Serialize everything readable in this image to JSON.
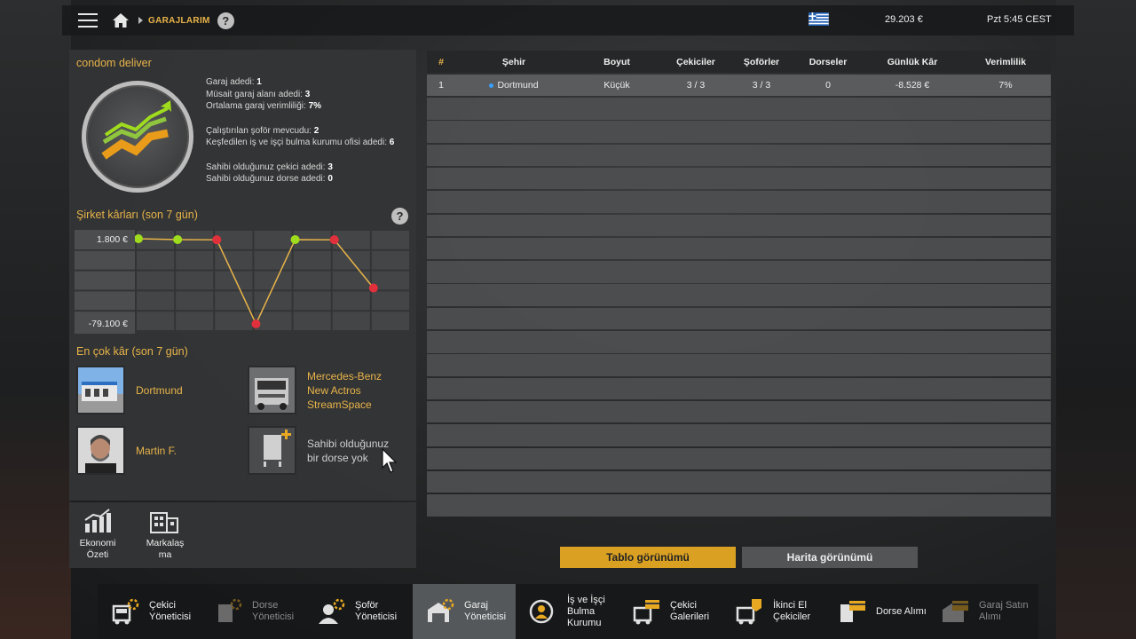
{
  "topbar": {
    "breadcrumb": "GARAJLARIM",
    "help": "?",
    "money": "29.203 €",
    "clock": "Pzt 5:45 CEST"
  },
  "company": {
    "name": "condom deliver",
    "stats": {
      "garages_label": "Garaj adedi:",
      "garages_value": "1",
      "free_slots_label": "Müsait garaj alanı adedi:",
      "free_slots_value": "3",
      "avg_eff_label": "Ortalama garaj verimliliği:",
      "avg_eff_value": "7%",
      "drivers_label": "Çalıştırılan şoför mevcudu:",
      "drivers_value": "2",
      "offices_label": "Keşfedilen iş ve işçi bulma kurumu ofisi adedi:",
      "offices_value": "6",
      "trucks_label": "Sahibi olduğunuz çekici adedi:",
      "trucks_value": "3",
      "trailers_label": "Sahibi olduğunuz dorse adedi:",
      "trailers_value": "0"
    }
  },
  "profit_chart": {
    "title": "Şirket kârları (son 7 gün)",
    "help": "?",
    "max_label": "1.800 €",
    "min_label": "-79.100 €"
  },
  "chart_data": {
    "type": "line",
    "title": "Şirket kârları (son 7 gün)",
    "x": [
      1,
      2,
      3,
      4,
      5,
      6,
      7
    ],
    "series": [
      {
        "values": [
          1800,
          1000,
          800,
          -79100,
          1000,
          800,
          -45000
        ]
      }
    ],
    "point_status": [
      "positive",
      "positive",
      "negative",
      "negative",
      "positive",
      "negative",
      "negative"
    ],
    "ylim": [
      -79100,
      1800
    ],
    "tick_labels": [
      "1.800 €",
      "-79.100 €"
    ],
    "colors": {
      "line": "#e8b44a",
      "positive": "#9fdc1e",
      "negative": "#e0303c"
    },
    "grid": true
  },
  "top_profit": {
    "title": "En çok kâr (son 7 gün)",
    "city": "Dortmund",
    "truck_line1": "Mercedes-Benz",
    "truck_line2": "New Actros",
    "truck_line3": "StreamSpace",
    "driver": "Martin F.",
    "trailer_line1": "Sahibi olduğunuz",
    "trailer_line2": "bir dorse yok"
  },
  "bottom_left": {
    "economy_line1": "Ekonomi",
    "economy_line2": "Özeti",
    "brand_line1": "Markalaş",
    "brand_line2": "ma"
  },
  "table": {
    "headers": [
      "#",
      "Şehir",
      "Boyut",
      "Çekiciler",
      "Şoförler",
      "Dorseler",
      "Günlük Kâr",
      "Verimlilik"
    ],
    "rows": [
      {
        "num": "1",
        "city": "Dortmund",
        "size": "Küçük",
        "trucks": "3 / 3",
        "drivers": "3 / 3",
        "trailers": "0",
        "profit": "-8.528 €",
        "efficiency": "7%"
      }
    ]
  },
  "view_buttons": {
    "table": "Tablo görünümü",
    "map": "Harita görünümü"
  },
  "bottombar": {
    "items": [
      {
        "l1": "Çekici",
        "l2": "Yöneticisi",
        "l3": ""
      },
      {
        "l1": "Dorse",
        "l2": "Yöneticisi",
        "l3": ""
      },
      {
        "l1": "Şoför",
        "l2": "Yöneticisi",
        "l3": ""
      },
      {
        "l1": "Garaj",
        "l2": "Yöneticisi",
        "l3": ""
      },
      {
        "l1": "İş ve İşçi",
        "l2": "Bulma",
        "l3": "Kurumu"
      },
      {
        "l1": "Çekici",
        "l2": "Galerileri",
        "l3": ""
      },
      {
        "l1": "İkinci El",
        "l2": "Çekiciler",
        "l3": ""
      },
      {
        "l1": "Dorse Alımı",
        "l2": "",
        "l3": ""
      },
      {
        "l1": "Garaj Satın",
        "l2": "Alımı",
        "l3": ""
      }
    ]
  }
}
